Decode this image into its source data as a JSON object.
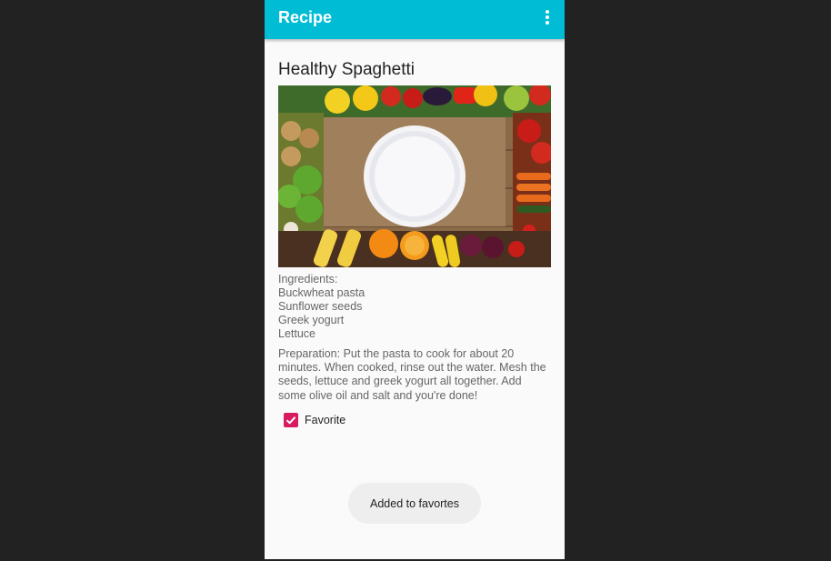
{
  "appbar": {
    "title": "Recipe",
    "menu_icon": "more-vert-icon",
    "color": "#00bcd4"
  },
  "recipe": {
    "title": "Healthy Spaghetti",
    "image_icon": "vegetable-frame-plate-photo",
    "ingredients_label": "Ingredients:",
    "ingredients": [
      "Buckwheat pasta",
      "Sunflower seeds",
      "Greek yogurt",
      "Lettuce"
    ],
    "preparation": "Preparation: Put the pasta to cook for about 20 minutes. When cooked, rinse out the water. Mesh the seeds, lettuce and greek yogurt all together. Add some olive oil and salt and you're done!"
  },
  "favorite": {
    "label": "Favorite",
    "checked": true,
    "color": "#d81b60"
  },
  "toast": {
    "text": "Added to favortes"
  }
}
